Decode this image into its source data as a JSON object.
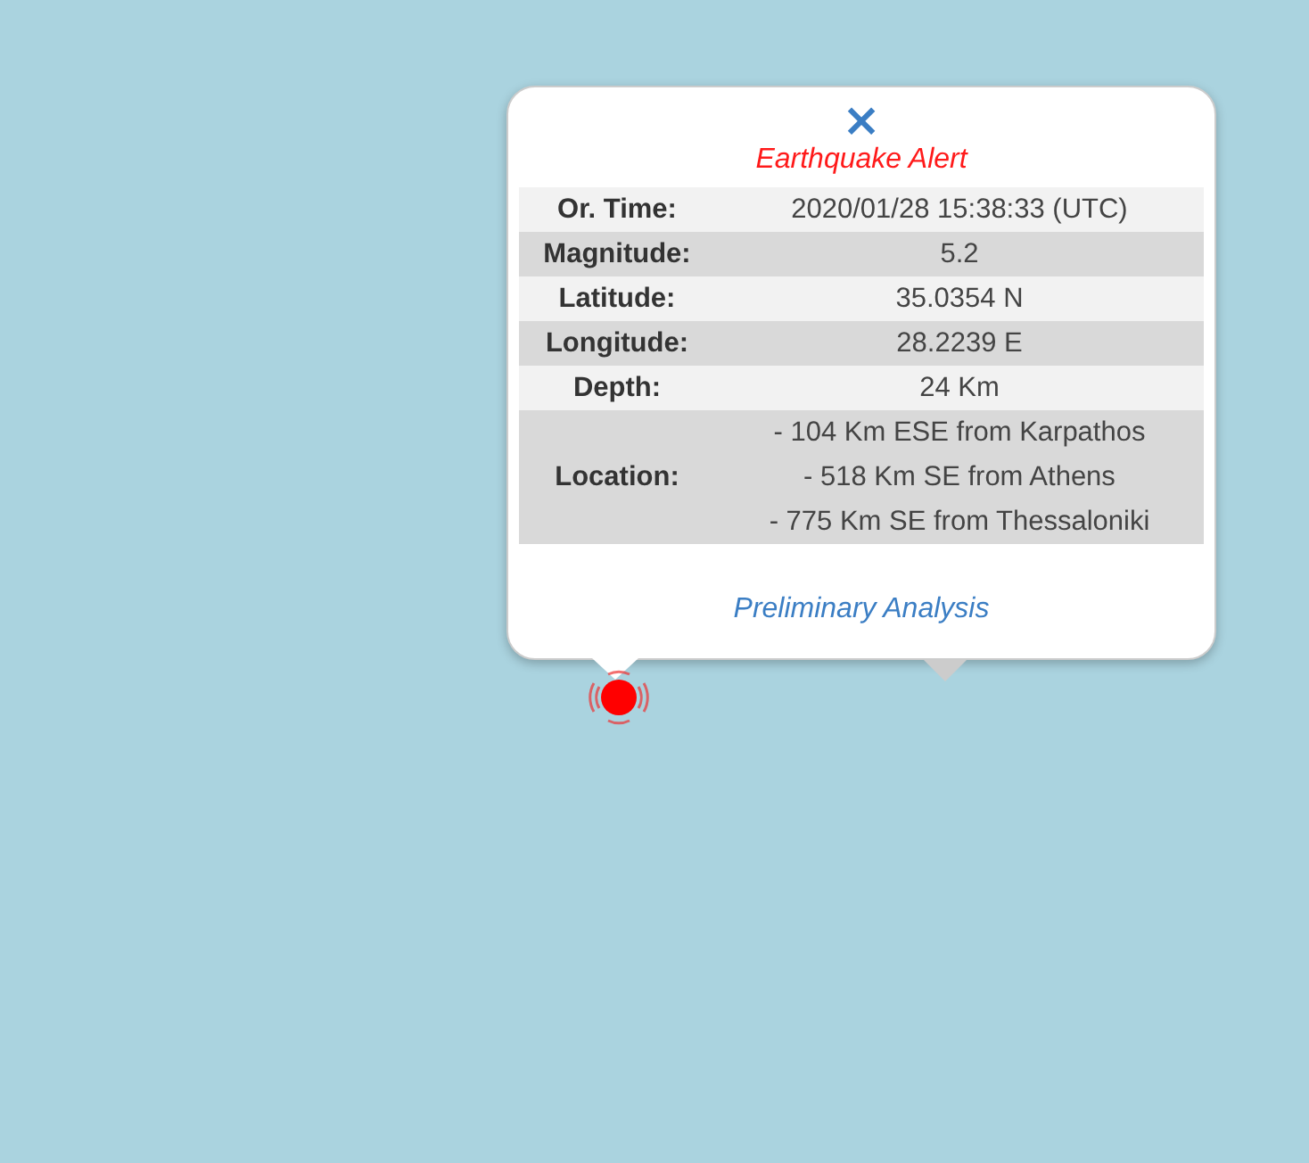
{
  "popup": {
    "close": "×",
    "title": "Earthquake Alert",
    "rows": [
      {
        "label": "Or. Time:",
        "lines": [
          "2020/01/28 15:38:33 (UTC)"
        ]
      },
      {
        "label": "Magnitude:",
        "lines": [
          "5.2"
        ]
      },
      {
        "label": "Latitude:",
        "lines": [
          "35.0354 N"
        ]
      },
      {
        "label": "Longitude:",
        "lines": [
          "28.2239 E"
        ]
      },
      {
        "label": "Depth:",
        "lines": [
          "24 Km"
        ]
      },
      {
        "label": "Location:",
        "lines": [
          "- 104 Km ESE from Karpathos",
          "- 518 Km SE from Athens",
          "- 775 Km SE from Thessaloniki"
        ]
      }
    ],
    "link": "Preliminary Analysis"
  }
}
